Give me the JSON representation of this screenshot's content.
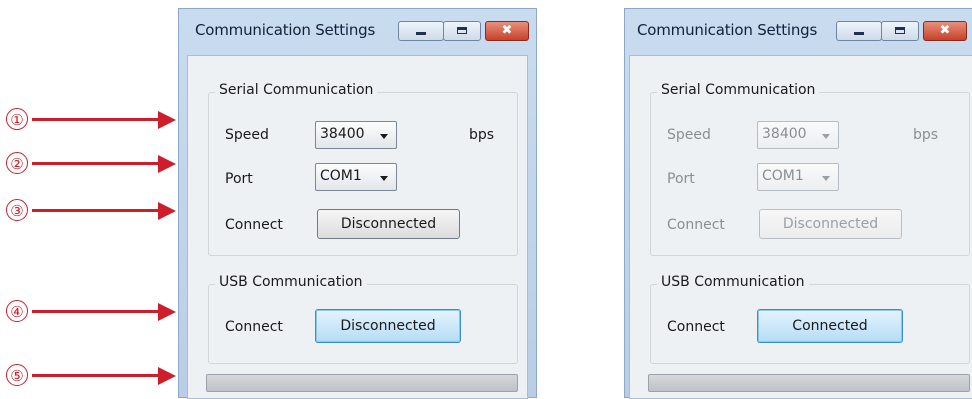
{
  "callouts": [
    "①",
    "②",
    "③",
    "④",
    "⑤"
  ],
  "left_window": {
    "title": "Communication Settings",
    "controls": {
      "minimize": "minimize-icon",
      "maximize": "maximize-icon",
      "close": "close-icon"
    },
    "close_glyph": "✖",
    "serial": {
      "legend": "Serial Communication",
      "speed_label": "Speed",
      "speed_value": "38400",
      "speed_unit": "bps",
      "port_label": "Port",
      "port_value": "COM1",
      "connect_label": "Connect",
      "connect_button": "Disconnected"
    },
    "usb": {
      "legend": "USB Communication",
      "connect_label": "Connect",
      "connect_button": "Disconnected"
    }
  },
  "right_window": {
    "title": "Communication Settings",
    "close_glyph": "✖",
    "serial": {
      "legend": "Serial Communication",
      "speed_label": "Speed",
      "speed_value": "38400",
      "speed_unit": "bps",
      "port_label": "Port",
      "port_value": "COM1",
      "connect_label": "Connect",
      "connect_button": "Disconnected"
    },
    "usb": {
      "legend": "USB Communication",
      "connect_label": "Connect",
      "connect_button": "Connected"
    }
  },
  "colors": {
    "callout_red": "#cc1f2b",
    "focus_blue": "#3b8fd0",
    "title_bar": "#c9dcef"
  }
}
